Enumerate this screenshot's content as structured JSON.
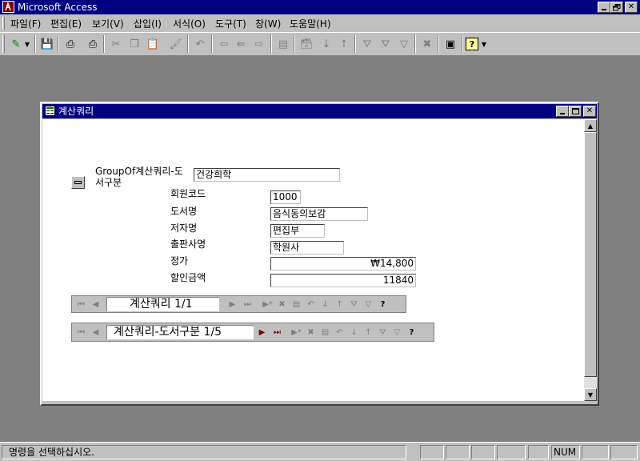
{
  "app": {
    "title": "Microsoft Access"
  },
  "menu": [
    "파일(F)",
    "편집(E)",
    "보기(V)",
    "삽입(I)",
    "서식(O)",
    "도구(T)",
    "창(W)",
    "도움말(H)"
  ],
  "form": {
    "title": "계산쿼리",
    "main_field": {
      "label": "GroupOf계산쿼리-도서구분",
      "label_line1": "GroupOf계산쿼리-도",
      "label_line2": "서구분",
      "value": "건강희학"
    },
    "fields": [
      {
        "label": "회원코드",
        "value": "1000",
        "align": "left"
      },
      {
        "label": "도서명",
        "value": "음식동의보감",
        "align": "left"
      },
      {
        "label": "저자명",
        "value": "편집부",
        "align": "left"
      },
      {
        "label": "출판사명",
        "value": "학원사",
        "align": "left"
      },
      {
        "label": "정가",
        "value": "₩14,800",
        "align": "right"
      },
      {
        "label": "할인금액",
        "value": "11840",
        "align": "right"
      }
    ],
    "subnav": {
      "record": "계산쿼리 1/1"
    },
    "mainnav": {
      "record": "계산쿼리-도서구분 1/5"
    }
  },
  "status": {
    "text": "명령을 선택하십시오.",
    "num": "NUM"
  }
}
